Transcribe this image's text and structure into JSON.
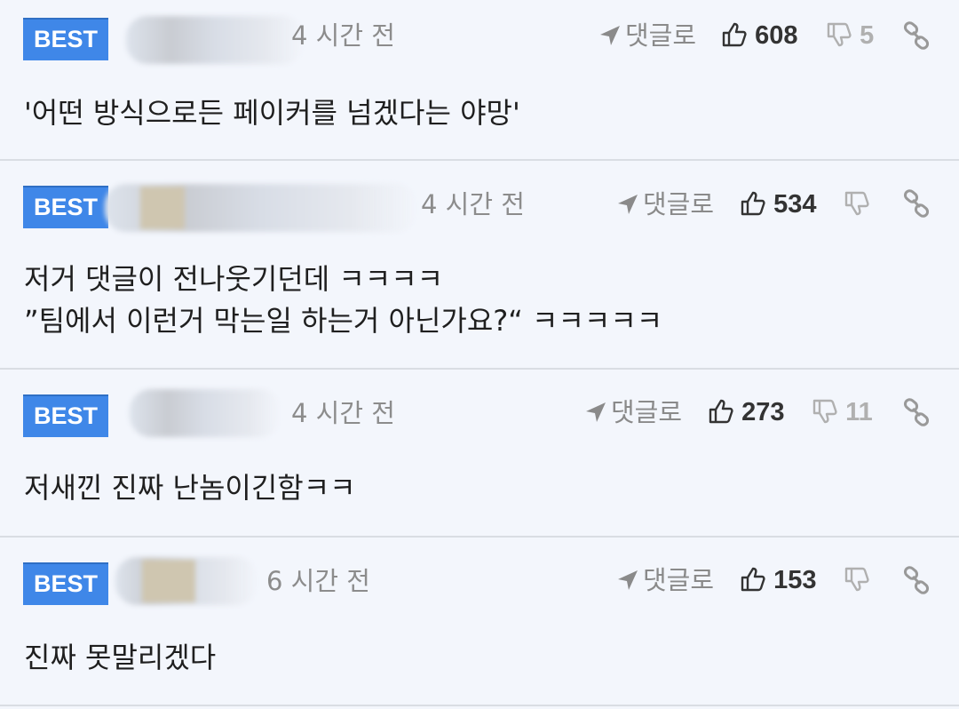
{
  "comments": [
    {
      "badge": "BEST",
      "time": "4 시간 전",
      "reply_label": "댓글로",
      "likes": "608",
      "dislikes": "5",
      "lines": [
        "'어떤 방식으로든 페이커를 넘겠다는 야망'"
      ]
    },
    {
      "badge": "BEST",
      "time": "4 시간 전",
      "reply_label": "댓글로",
      "likes": "534",
      "dislikes": "",
      "lines": [
        "저거 댓글이 전나웃기던데 ㅋㅋㅋㅋ",
        "”팀에서 이런거 막는일 하는거 아닌가요?“ ㅋㅋㅋㅋㅋ"
      ]
    },
    {
      "badge": "BEST",
      "time": "4 시간 전",
      "reply_label": "댓글로",
      "likes": "273",
      "dislikes": "11",
      "lines": [
        "저새낀 진짜 난놈이긴함ㅋㅋ"
      ]
    },
    {
      "badge": "BEST",
      "time": "6 시간 전",
      "reply_label": "댓글로",
      "likes": "153",
      "dislikes": "",
      "lines": [
        "진짜 못말리겠다"
      ]
    }
  ],
  "colors": {
    "badge": "#3f87e8",
    "background": "#f3f6fc",
    "muted_text": "#8c8c8c"
  },
  "icons": {
    "reply": "send-arrow-icon",
    "like": "thumbs-up-icon",
    "dislike": "thumbs-down-icon",
    "link": "link-chain-icon"
  }
}
